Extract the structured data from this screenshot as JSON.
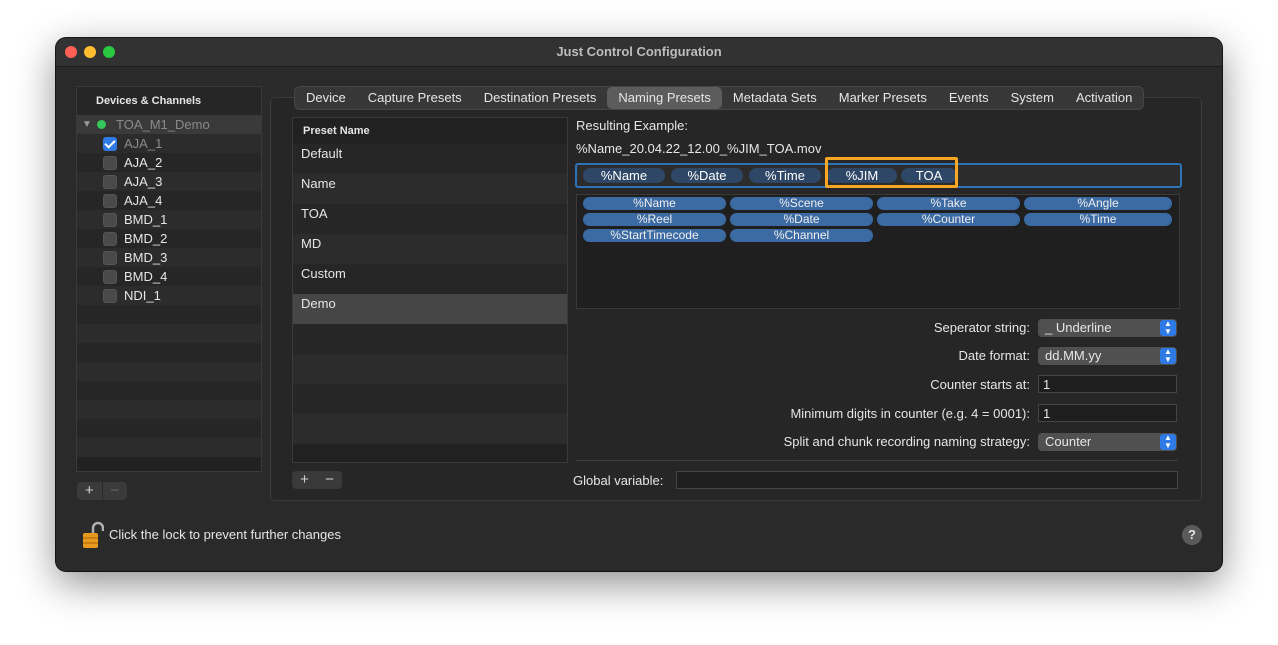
{
  "window": {
    "title": "Just Control Configuration"
  },
  "sidebar": {
    "header": "Devices & Channels",
    "group": {
      "label": "TOA_M1_Demo",
      "status_color": "#34c759"
    },
    "channels": [
      {
        "label": "AJA_1",
        "checked": true
      },
      {
        "label": "AJA_2",
        "checked": false
      },
      {
        "label": "AJA_3",
        "checked": false
      },
      {
        "label": "AJA_4",
        "checked": false
      },
      {
        "label": "BMD_1",
        "checked": false
      },
      {
        "label": "BMD_2",
        "checked": false
      },
      {
        "label": "BMD_3",
        "checked": false
      },
      {
        "label": "BMD_4",
        "checked": false
      },
      {
        "label": "NDI_1",
        "checked": false
      }
    ],
    "add_label": "+",
    "remove_label": "−"
  },
  "tabs": [
    "Device",
    "Capture Presets",
    "Destination Presets",
    "Naming Presets",
    "Metadata Sets",
    "Marker Presets",
    "Events",
    "System",
    "Activation"
  ],
  "active_tab": "Naming Presets",
  "presets": {
    "header": "Preset Name",
    "items": [
      "Default",
      "Name",
      "TOA",
      "MD",
      "Custom",
      "Demo"
    ],
    "selected": "Demo",
    "add_label": "+",
    "remove_label": "−"
  },
  "naming": {
    "result_label": "Resulting Example:",
    "result_value": "%Name_20.04.22_12.00_%JIM_TOA.mov",
    "tokens": [
      "%Name",
      "%Date",
      "%Time",
      "%JIM",
      "TOA"
    ],
    "variables": [
      "%Name",
      "%Scene",
      "%Take",
      "%Angle",
      "%Reel",
      "%Date",
      "%Counter",
      "%Time",
      "%StartTimecode",
      "%Channel"
    ],
    "separator_label": "Seperator string:",
    "separator_value": "_ Underline",
    "date_format_label": "Date format:",
    "date_format_value": "dd.MM.yy",
    "counter_label": "Counter starts at:",
    "counter_value": "1",
    "min_digits_label": "Minimum digits in counter (e.g. 4 = 0001):",
    "min_digits_value": "1",
    "split_label": "Split and chunk recording naming strategy:",
    "split_value": "Counter",
    "global_label": "Global variable:",
    "global_value": ""
  },
  "footer": {
    "lock_text": "Click the lock to prevent further changes",
    "help_label": "?"
  },
  "colors": {
    "accent": "#2f7be5",
    "highlight": "#f5a623",
    "token": "#2e4766",
    "pill": "#3c6aa3"
  }
}
